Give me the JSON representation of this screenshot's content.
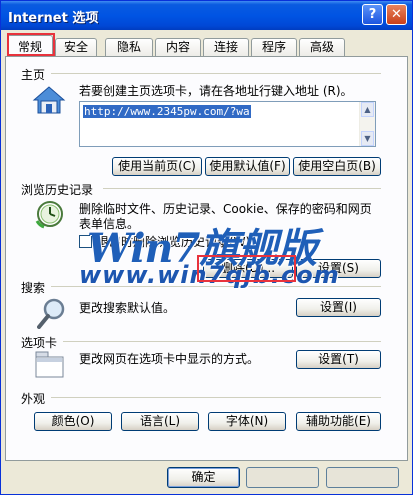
{
  "window": {
    "title": "Internet 选项",
    "help_glyph": "?",
    "close_glyph": "✕"
  },
  "tabs": [
    {
      "label": "常规",
      "active": true
    },
    {
      "label": "安全"
    },
    {
      "label": "隐私"
    },
    {
      "label": "内容"
    },
    {
      "label": "连接"
    },
    {
      "label": "程序"
    },
    {
      "label": "高级"
    }
  ],
  "home": {
    "group_label": "主页",
    "description": "若要创建主页选项卡，请在各地址行键入地址 (R)。",
    "url": "http://www.2345pw.com/?wa",
    "buttons": {
      "use_current": "使用当前页(C)",
      "use_default": "使用默认值(F)",
      "use_blank": "使用空白页(B)"
    }
  },
  "history": {
    "group_label": "浏览历史记录",
    "description_line1": "删除临时文件、历史记录、Cookie、保存的密码和网页",
    "description_line2": "表单信息。",
    "checkbox_label": "退出时删除浏览历史记录(W)",
    "delete_button": "删除(D)...",
    "settings_button": "设置(S)"
  },
  "search": {
    "group_label": "搜索",
    "description": "更改搜索默认值。",
    "settings_button": "设置(I)"
  },
  "tabs_group": {
    "group_label": "选项卡",
    "description": "更改网页在选项卡中显示的方式。",
    "settings_button": "设置(T)"
  },
  "appearance": {
    "group_label": "外观",
    "buttons": [
      "颜色(O)",
      "语言(L)",
      "字体(N)",
      "辅助功能(E)"
    ]
  },
  "footer": {
    "ok_button": "确定"
  },
  "watermark": {
    "line1": "Win7旗舰版",
    "line2": "www.win7qjb.com"
  },
  "colors": {
    "title_bar": "#0054E3",
    "dialog_bg": "#ECE9D8",
    "highlight": "#E8323C",
    "watermark": "#1F5FB8"
  }
}
